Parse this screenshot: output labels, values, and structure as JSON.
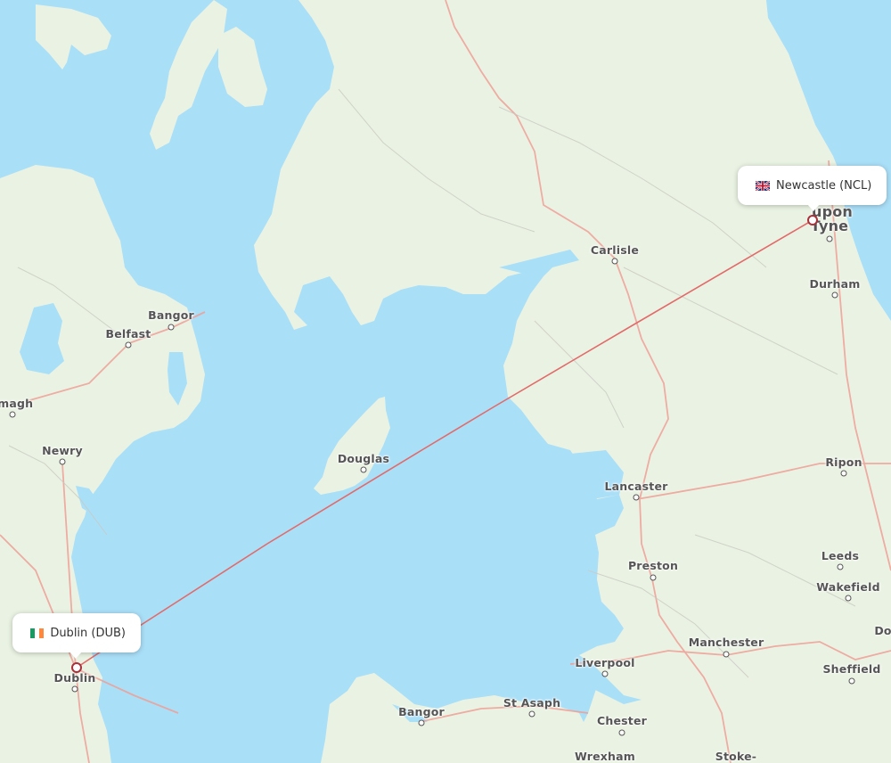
{
  "map": {
    "colors": {
      "water": "#aadff8",
      "land": "#eaf3e3",
      "major_road": "#ef9f96",
      "minor_road": "#c9c9c2",
      "route": "#e36a6a",
      "pin": "#a8313a"
    }
  },
  "route": {
    "origin": {
      "city": "Dublin",
      "code": "DUB",
      "label": "Dublin (DUB)",
      "country": "Ireland",
      "flag": "ie-flag"
    },
    "destination": {
      "city": "Newcastle",
      "code": "NCL",
      "label": "Newcastle (NCL)",
      "country": "United Kingdom",
      "flag": "gb-flag"
    }
  },
  "cities": [
    {
      "name": "Carlisle"
    },
    {
      "name": "Durham"
    },
    {
      "name": "Ripon"
    },
    {
      "name": "Lancaster"
    },
    {
      "name": "Preston"
    },
    {
      "name": "Leeds"
    },
    {
      "name": "Wakefield"
    },
    {
      "name": "Manchester"
    },
    {
      "name": "Liverpool"
    },
    {
      "name": "Sheffield"
    },
    {
      "name": "Chester"
    },
    {
      "name": "Wrexham"
    },
    {
      "name": "Stoke-"
    },
    {
      "name": "St Asaph"
    },
    {
      "name": "Bangor"
    },
    {
      "name": "Douglas"
    },
    {
      "name": "Dublin"
    },
    {
      "name": "Newry"
    },
    {
      "name": "rmagh"
    },
    {
      "name": "Belfast"
    },
    {
      "name": "Bangor"
    },
    {
      "name": "Do"
    },
    {
      "name": "upon"
    },
    {
      "name": "Tyne"
    }
  ]
}
